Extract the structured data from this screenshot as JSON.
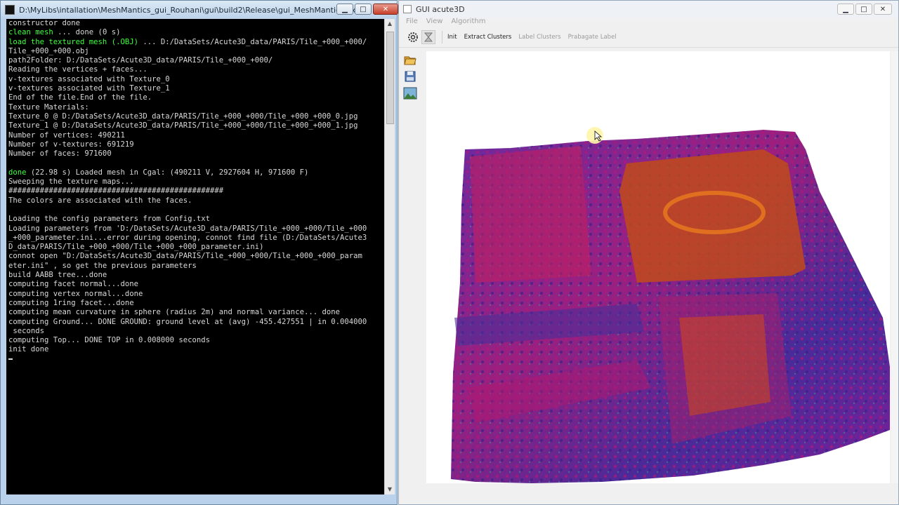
{
  "console": {
    "title": "D:\\MyLibs\\intallation\\MeshMantics_gui_Rouhani\\gui\\build2\\Release\\gui_MeshMantics.exe",
    "lines": [
      {
        "t": "constructor done"
      },
      {
        "g": "clean mesh",
        "t": " ... done (0 s)"
      },
      {
        "g": "load the textured mesh (.OBJ)",
        "t": " ... D:/DataSets/Acute3D_data/PARIS/Tile_+000_+000/"
      },
      {
        "t": "Tile_+000_+000.obj"
      },
      {
        "t": "path2Folder: D:/DataSets/Acute3D_data/PARIS/Tile_+000_+000/"
      },
      {
        "t": "Reading the vertices + faces..."
      },
      {
        "t": "v-textures associated with Texture_0"
      },
      {
        "t": "v-textures associated with Texture_1"
      },
      {
        "t": "End of the file.End of the file."
      },
      {
        "t": "Texture Materials:"
      },
      {
        "t": "Texture_0 @ D:/DataSets/Acute3D_data/PARIS/Tile_+000_+000/Tile_+000_+000_0.jpg"
      },
      {
        "t": "Texture_1 @ D:/DataSets/Acute3D_data/PARIS/Tile_+000_+000/Tile_+000_+000_1.jpg"
      },
      {
        "t": "Number of vertices: 490211"
      },
      {
        "t": "Number of v-textures: 691219"
      },
      {
        "t": "Number of faces: 971600"
      },
      {
        "t": ""
      },
      {
        "g": "done",
        "t": " (22.98 s) Loaded mesh in Cgal: (490211 V, 2927604 H, 971600 F)"
      },
      {
        "t": "Sweeping the texture maps..."
      },
      {
        "t": "################################################"
      },
      {
        "t": "The colors are associated with the faces."
      },
      {
        "t": ""
      },
      {
        "t": "Loading the config parameters from Config.txt"
      },
      {
        "t": "Loading parameters from 'D:/DataSets/Acute3D_data/PARIS/Tile_+000_+000/Tile_+000"
      },
      {
        "t": "_+000_parameter.ini...error during opening, connot find file (D:/DataSets/Acute3"
      },
      {
        "t": "D_data/PARIS/Tile_+000_+000/Tile_+000_+000_parameter.ini)"
      },
      {
        "t": "connot open \"D:/DataSets/Acute3D_data/PARIS/Tile_+000_+000/Tile_+000_+000_param"
      },
      {
        "t": "eter.ini\" , so get the previous parameters"
      },
      {
        "t": "build AABB tree...done"
      },
      {
        "t": "computing facet normal...done"
      },
      {
        "t": "computing vertex normal...done"
      },
      {
        "t": "computing 1ring facet...done"
      },
      {
        "t": "computing mean curvature in sphere (radius 2m) and normal variance... done"
      },
      {
        "t": "computing Ground... DONE GROUND: ground level at (avg) -455.427551 | in 0.004000"
      },
      {
        "t": " seconds"
      },
      {
        "t": "computing Top... DONE TOP in 0.008000 seconds"
      },
      {
        "t": "init done"
      }
    ]
  },
  "gui": {
    "title": "GUI acute3D",
    "menu": [
      "File",
      "View",
      "Algorithm"
    ],
    "toolbar": {
      "actions": [
        {
          "label": "Init",
          "enabled": true
        },
        {
          "label": "Extract Clusters",
          "enabled": true
        },
        {
          "label": "Label Clusters",
          "enabled": false
        },
        {
          "label": "Prabagate Label",
          "enabled": false
        }
      ]
    },
    "icons": {
      "toolbar": [
        "settings-gear-icon",
        "hourglass-icon"
      ],
      "sidebar": [
        "open-folder-icon",
        "save-icon",
        "image-icon"
      ]
    }
  },
  "window_buttons": {
    "minimize": "▁",
    "maximize": "□",
    "close": "✕"
  },
  "colors": {
    "console_bg": "#000000",
    "console_text": "#d8d8d8",
    "console_highlight": "#3cff3c",
    "mesh_magenta": "#a0207a",
    "mesh_orange": "#e0501a",
    "mesh_blue": "#4a2a9a"
  }
}
